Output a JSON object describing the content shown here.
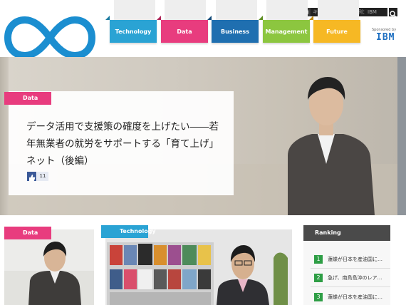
{
  "brand": {
    "name": "mugendai"
  },
  "search": {
    "placeholder": "キーワードを入力　例：IBM"
  },
  "social_icons": [
    "rss-icon",
    "twitter-icon",
    "facebook-icon",
    "google-plus-icon"
  ],
  "nav": {
    "tabs": [
      {
        "label": "Technology",
        "color": "#2aa3d4"
      },
      {
        "label": "Data",
        "color": "#e83c7e"
      },
      {
        "label": "Business",
        "color": "#1f6fb0"
      },
      {
        "label": "Management",
        "color": "#8cc63f"
      },
      {
        "label": "Future",
        "color": "#f6b824"
      }
    ]
  },
  "sponsor": {
    "label": "Sponsored by",
    "logo_text": "IBM"
  },
  "hero": {
    "category": "Data",
    "title": "データ活用で支援策の確度を上げたい――若年無業者の就労をサポートする「育て上げ」ネット（後編）",
    "like_count": "11"
  },
  "cards": [
    {
      "category": "Data"
    },
    {
      "category": "Technology"
    }
  ],
  "ranking": {
    "heading": "Ranking",
    "items": [
      {
        "rank": "1",
        "text": "蓮蝶が日本を産油国に…"
      },
      {
        "rank": "2",
        "text": "急げ、南鳥島沖のレア…"
      },
      {
        "rank": "3",
        "text": "蓮蝶が日本を産油国に…"
      }
    ]
  }
}
